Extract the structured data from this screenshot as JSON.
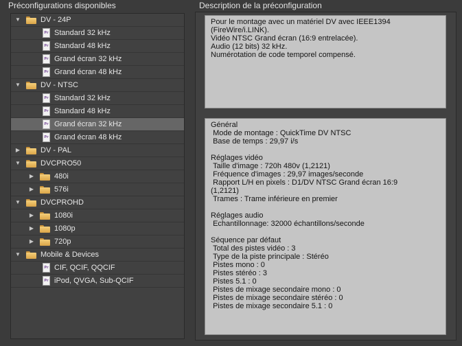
{
  "left_title": "Préconfigurations disponibles",
  "right_title": "Description de la préconfiguration",
  "tree": [
    {
      "type": "folder",
      "label": "DV - 24P",
      "expanded": true,
      "level": 0
    },
    {
      "type": "preset",
      "label": "Standard 32 kHz",
      "level": 1
    },
    {
      "type": "preset",
      "label": "Standard 48 kHz",
      "level": 1
    },
    {
      "type": "preset",
      "label": "Grand écran 32 kHz",
      "level": 1
    },
    {
      "type": "preset",
      "label": "Grand écran 48 kHz",
      "level": 1
    },
    {
      "type": "folder",
      "label": "DV - NTSC",
      "expanded": true,
      "level": 0
    },
    {
      "type": "preset",
      "label": "Standard 32 kHz",
      "level": 1
    },
    {
      "type": "preset",
      "label": "Standard 48 kHz",
      "level": 1
    },
    {
      "type": "preset",
      "label": "Grand écran 32 kHz",
      "level": 1,
      "selected": true
    },
    {
      "type": "preset",
      "label": "Grand écran 48 kHz",
      "level": 1
    },
    {
      "type": "folder",
      "label": "DV - PAL",
      "expanded": false,
      "level": 0
    },
    {
      "type": "folder",
      "label": "DVCPRO50",
      "expanded": true,
      "level": 0
    },
    {
      "type": "folder",
      "label": "480i",
      "expanded": false,
      "level": 1
    },
    {
      "type": "folder",
      "label": "576i",
      "expanded": false,
      "level": 1
    },
    {
      "type": "folder",
      "label": "DVCPROHD",
      "expanded": true,
      "level": 0
    },
    {
      "type": "folder",
      "label": "1080i",
      "expanded": false,
      "level": 1
    },
    {
      "type": "folder",
      "label": "1080p",
      "expanded": false,
      "level": 1
    },
    {
      "type": "folder",
      "label": "720p",
      "expanded": false,
      "level": 1
    },
    {
      "type": "folder",
      "label": "Mobile & Devices",
      "expanded": true,
      "level": 0
    },
    {
      "type": "preset",
      "label": "CIF, QCIF, QQCIF",
      "level": 1
    },
    {
      "type": "preset",
      "label": "iPod, QVGA, Sub-QCIF",
      "level": 1
    }
  ],
  "preset_icon_text": "Pr",
  "description": "Pour le montage avec un matériel DV avec IEEE1394\n(FireWire/i.LINK).\nVidéo NTSC Grand écran (16:9 entrelacée).\nAudio (12 bits) 32 kHz.\nNumérotation de code temporel compensé.",
  "details": "Général\n Mode de montage : QuickTime DV NTSC\n Base de temps : 29,97 i/s\n\nRéglages vidéo\n Taille d'image : 720h 480v (1,2121)\n Fréquence d'images : 29,97 images/seconde\n Rapport L/H en pixels : D1/DV NTSC Grand écran 16:9\n(1,2121)\n Trames : Trame inférieure en premier\n\nRéglages audio\n Echantillonnage: 32000 échantillons/seconde\n\nSéquence par défaut\n Total des pistes vidéo : 3\n Type de la piste principale : Stéréo\n Pistes mono : 0\n Pistes stéréo : 3\n Pistes 5.1 : 0\n Pistes de mixage secondaire mono : 0\n Pistes de mixage secondaire stéréo : 0\n Pistes de mixage secondaire 5.1 : 0"
}
